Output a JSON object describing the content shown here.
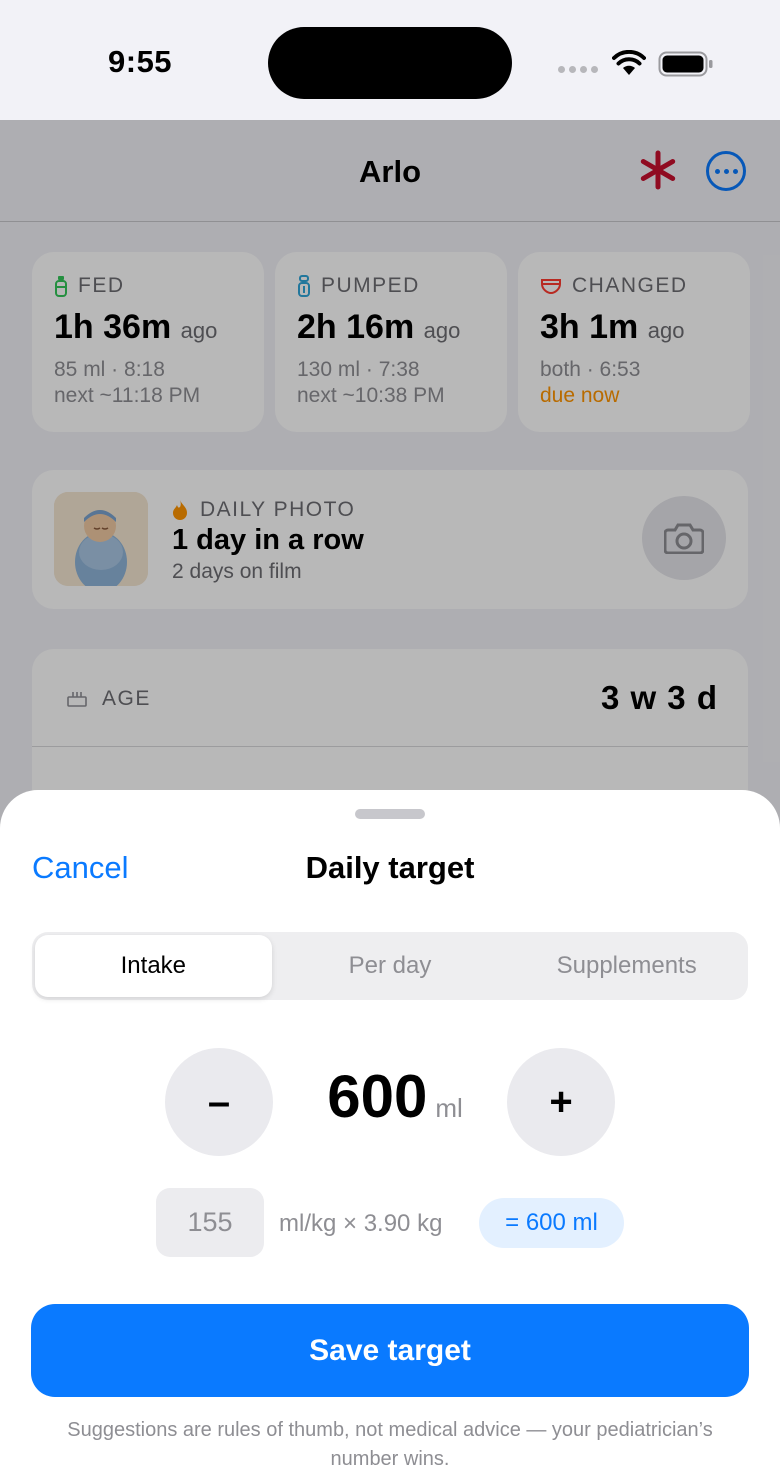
{
  "status": {
    "time": "9:55"
  },
  "nav": {
    "title": "Arlo"
  },
  "stats": [
    {
      "label": "FED",
      "value": "1h 36m",
      "ago": "ago",
      "line1": "85 ml · 8:18",
      "line2": "next ~11:18 PM"
    },
    {
      "label": "PUMPED",
      "value": "2h 16m",
      "ago": "ago",
      "line1": "130 ml · 7:38",
      "line2": "next ~10:38 PM"
    },
    {
      "label": "CHANGED",
      "value": "3h 1m",
      "ago": "ago",
      "line1": "both · 6:53",
      "line2": "due now"
    }
  ],
  "photo": {
    "label": "DAILY PHOTO",
    "streak": "1 day in a row",
    "sub": "2 days on film"
  },
  "age": {
    "label": "AGE",
    "value": "3 w 3 d"
  },
  "sheet": {
    "cancel": "Cancel",
    "title": "Daily target",
    "tabs": [
      "Intake",
      "Per day",
      "Supplements"
    ],
    "minus": "–",
    "plus": "+",
    "amount": "600",
    "unit": "ml",
    "mlkg_value": "155",
    "mlkg_text": "ml/kg × 3.90 kg",
    "result": "= 600 ml",
    "save": "Save target",
    "disclaimer": "Suggestions are rules of thumb, not medical advice — your pediatrician’s number wins."
  },
  "colors": {
    "accent": "#0a7aff",
    "warning": "#ff9500",
    "asterisk": "#c8102e"
  }
}
